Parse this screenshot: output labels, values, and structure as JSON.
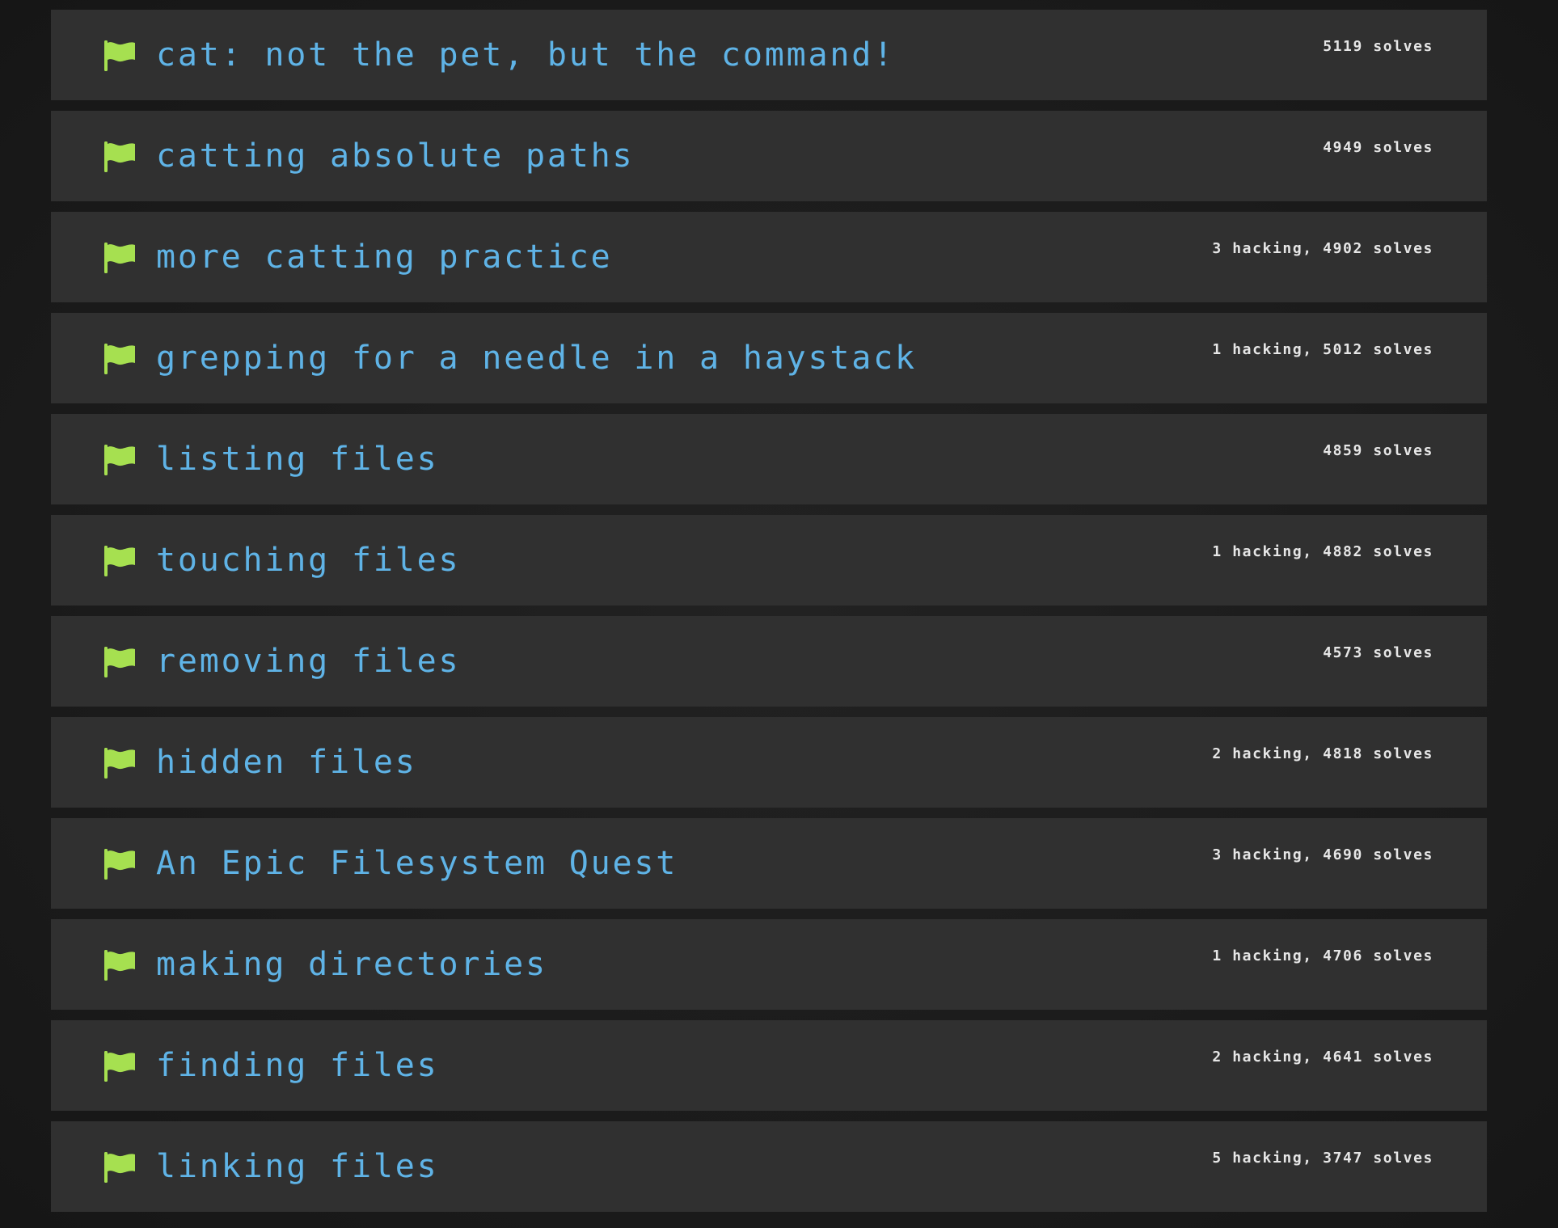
{
  "colors": {
    "background": "#1b1b1b",
    "row_background": "#303030",
    "title": "#5fb3e6",
    "flag": "#a6e050",
    "stats": "#e6e6e6"
  },
  "challenges": [
    {
      "title": "cat: not the pet, but the command!",
      "stats": "5119 solves",
      "icon": "flag-icon"
    },
    {
      "title": "catting absolute paths",
      "stats": "4949 solves",
      "icon": "flag-icon"
    },
    {
      "title": "more catting practice",
      "stats": "3 hacking, 4902 solves",
      "icon": "flag-icon"
    },
    {
      "title": "grepping for a needle in a haystack",
      "stats": "1 hacking, 5012 solves",
      "icon": "flag-icon"
    },
    {
      "title": "listing files",
      "stats": "4859 solves",
      "icon": "flag-icon"
    },
    {
      "title": "touching files",
      "stats": "1 hacking, 4882 solves",
      "icon": "flag-icon"
    },
    {
      "title": "removing files",
      "stats": "4573 solves",
      "icon": "flag-icon"
    },
    {
      "title": "hidden files",
      "stats": "2 hacking, 4818 solves",
      "icon": "flag-icon"
    },
    {
      "title": "An Epic Filesystem Quest",
      "stats": "3 hacking, 4690 solves",
      "icon": "flag-icon"
    },
    {
      "title": "making directories",
      "stats": "1 hacking, 4706 solves",
      "icon": "flag-icon"
    },
    {
      "title": "finding files",
      "stats": "2 hacking, 4641 solves",
      "icon": "flag-icon"
    },
    {
      "title": "linking files",
      "stats": "5 hacking, 3747 solves",
      "icon": "flag-icon"
    }
  ]
}
